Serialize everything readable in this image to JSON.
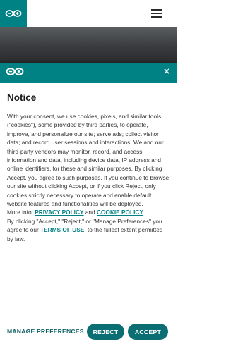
{
  "header": {
    "logo_icon": "arduino-infinity-icon",
    "menu_icon": "hamburger-menu-icon"
  },
  "banner": {
    "logo_icon": "arduino-infinity-icon",
    "close_label": "×",
    "title": "Notice",
    "body_main": "With your consent, we use cookies, pixels, and similar tools (\"cookies\"), some provided by third parties, to operate, improve, and personalize our site; serve ads; collect visitor data; and record user sessions and interactions. We and our third-party vendors may monitor, record, and access information and data, including device data, IP address and online identifiers, for these and similar purposes. By clicking Accept, you agree to such purposes. If you continue to browse our site without clicking Accept, or if you click Reject, only cookies strictly necessary to operate and enable default website features and functionalities will be deployed.",
    "more_info_prefix": "More info: ",
    "privacy_link": "PRIVACY POLICY",
    "and_text": " and ",
    "cookie_link": "COOKIE POLICY",
    "period": ".",
    "agree_prefix": "By clicking \"Accept,\" \"Reject,\" or \"Manage Preferences\" you agree to our ",
    "terms_link": "TERMS OF USE",
    "agree_suffix": ", to the fullest extent permitted by law.",
    "manage_label": "MANAGE PREFERENCES",
    "reject_label": "REJECT",
    "accept_label": "ACCEPT"
  },
  "colors": {
    "brand_teal": "#008184",
    "button_teal": "#0b6e72"
  }
}
